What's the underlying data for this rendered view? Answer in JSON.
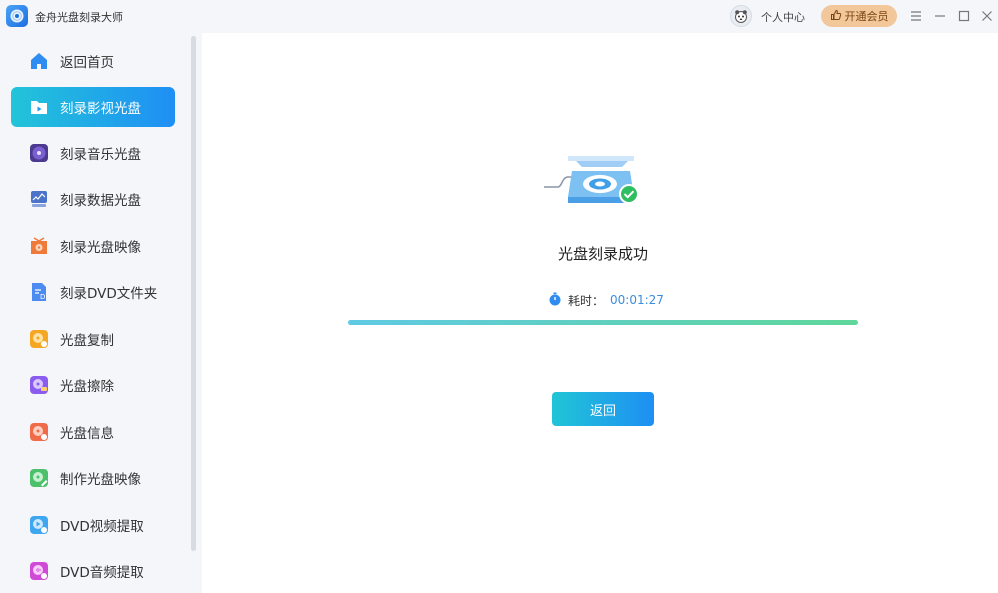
{
  "app": {
    "title": "金舟光盘刻录大师"
  },
  "header": {
    "user_center": "个人中心",
    "vip_button": "开通会员"
  },
  "sidebar": {
    "items": [
      {
        "label": "返回首页",
        "icon": "home-icon",
        "color": "#2f8cf0"
      },
      {
        "label": "刻录影视光盘",
        "icon": "video-disc-icon",
        "color": "#ffffff",
        "active": true
      },
      {
        "label": "刻录音乐光盘",
        "icon": "music-disc-icon",
        "color": "#5b3fa0"
      },
      {
        "label": "刻录数据光盘",
        "icon": "data-disc-icon",
        "color": "#4a73c9"
      },
      {
        "label": "刻录光盘映像",
        "icon": "disc-image-icon",
        "color": "#f07a3a"
      },
      {
        "label": "刻录DVD文件夹",
        "icon": "dvd-folder-icon",
        "color": "#4c8cf0"
      },
      {
        "label": "光盘复制",
        "icon": "disc-copy-icon",
        "color": "#f5a623"
      },
      {
        "label": "光盘擦除",
        "icon": "disc-erase-icon",
        "color": "#8a5cf0"
      },
      {
        "label": "光盘信息",
        "icon": "disc-info-icon",
        "color": "#f06b4a"
      },
      {
        "label": "制作光盘映像",
        "icon": "make-image-icon",
        "color": "#4cc06a"
      },
      {
        "label": "DVD视频提取",
        "icon": "dvd-video-extract-icon",
        "color": "#3fa6f0"
      },
      {
        "label": "DVD音频提取",
        "icon": "dvd-audio-extract-icon",
        "color": "#d04ad8"
      }
    ]
  },
  "main": {
    "status": "光盘刻录成功",
    "elapsed_label": "耗时：",
    "elapsed_value": "00:01:27",
    "progress": 1.0,
    "back_button": "返回"
  }
}
